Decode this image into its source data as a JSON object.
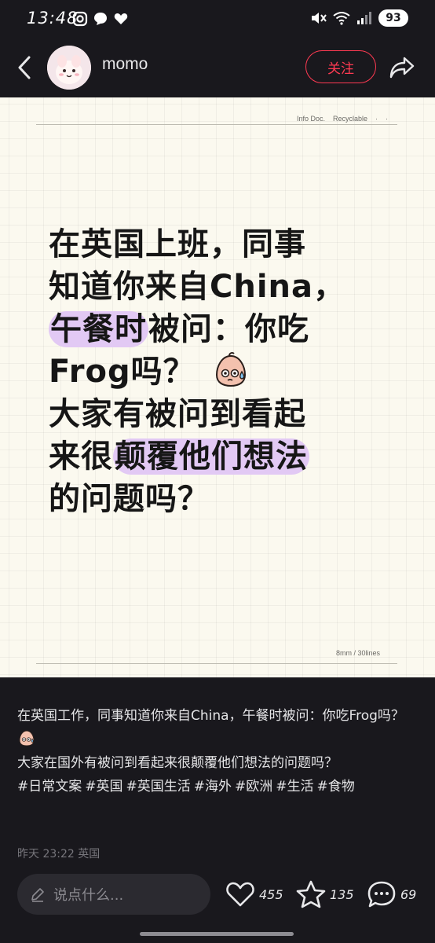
{
  "status_bar": {
    "time": "13:48",
    "battery": "93",
    "icons_left": [
      "instagram-icon",
      "chat-bubble-icon",
      "heart-icon"
    ],
    "icons_right": [
      "mute-icon",
      "wifi-icon",
      "signal-icon",
      "battery-icon"
    ]
  },
  "header": {
    "author_name": "momo",
    "follow_label": "关注"
  },
  "post_image": {
    "doc_label": "Info Doc.",
    "doc_tag": "Recyclable",
    "lines_label": "8mm / 30lines",
    "headline": {
      "line1": "在英国上班，同事",
      "line2": "知道你来自China，",
      "line3_hl": "午餐时",
      "line3_rest": "被问：你吃",
      "line4": "Frog吗？",
      "line5": "大家有被问到看起",
      "line6_pre": "来很",
      "line6_hl": "颠覆他们想法",
      "line7": "的问题吗？"
    },
    "highlight_color": "#e2c9f4"
  },
  "caption": {
    "line1": "在英国工作，同事知道你来自China，午餐时被问：你吃Frog吗？",
    "line2": "大家在国外有被问到看起来很颠覆他们想法的问题吗？",
    "hashtags": [
      "#日常文案",
      "#英国",
      "#英国生活",
      "#海外",
      "#欧洲",
      "#生活",
      "#食物"
    ]
  },
  "post_date": "昨天 23:22 英国",
  "bottom_bar": {
    "comment_placeholder": "说点什么...",
    "likes": "455",
    "collects": "135",
    "comments": "69"
  },
  "colors": {
    "background": "#19181d",
    "accent": "#ff3a52",
    "paper": "#fbf9ef"
  }
}
